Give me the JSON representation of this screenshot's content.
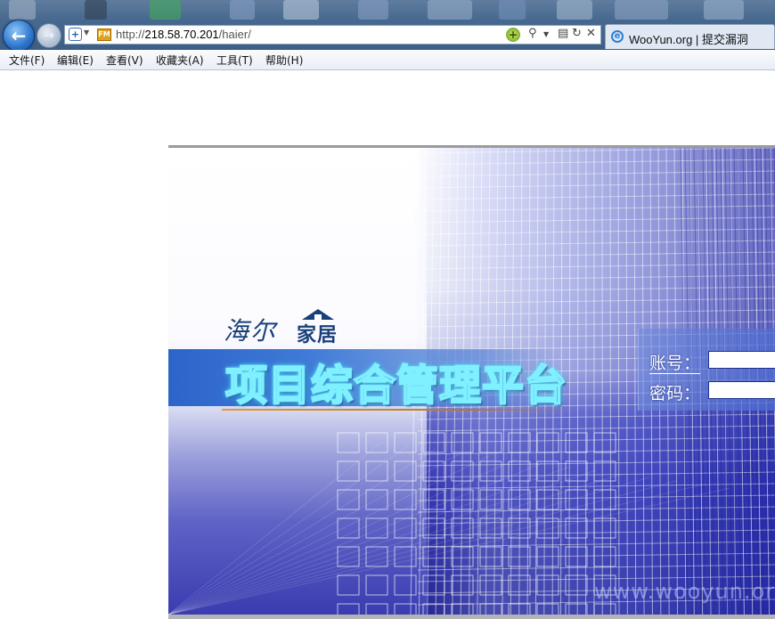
{
  "browser": {
    "url_prefix": "http://",
    "url_host": "218.58.70.201",
    "url_path": "/haier/",
    "tab_title": "WooYun.org | 提交漏洞",
    "site_icon_text": "FM",
    "icons": {
      "back": "back-arrow-icon",
      "forward": "forward-arrow-icon",
      "compat": "compatibility-view-icon",
      "site": "site-favicon-icon",
      "addon": "green-plus-icon",
      "search": "search-icon",
      "refresh": "refresh-icon",
      "stop": "close-icon",
      "tab": "ie-logo-icon"
    }
  },
  "menu": [
    "文件(F)",
    "编辑(E)",
    "查看(V)",
    "收藏夹(A)",
    "工具(T)",
    "帮助(H)"
  ],
  "page": {
    "logo_script": "海尔",
    "logo_brand": "家居",
    "title": "项目综合管理平台",
    "login": {
      "account_label": "账号：",
      "password_label": "密码：",
      "account_value": "",
      "password_value": ""
    },
    "watermark": "www.wooyun.org"
  },
  "colors": {
    "title_fill": "#0e2a7a",
    "title_glow": "#7ff0ff",
    "hero_dark": "#1e1f8f",
    "logo": "#1a3f7a"
  }
}
